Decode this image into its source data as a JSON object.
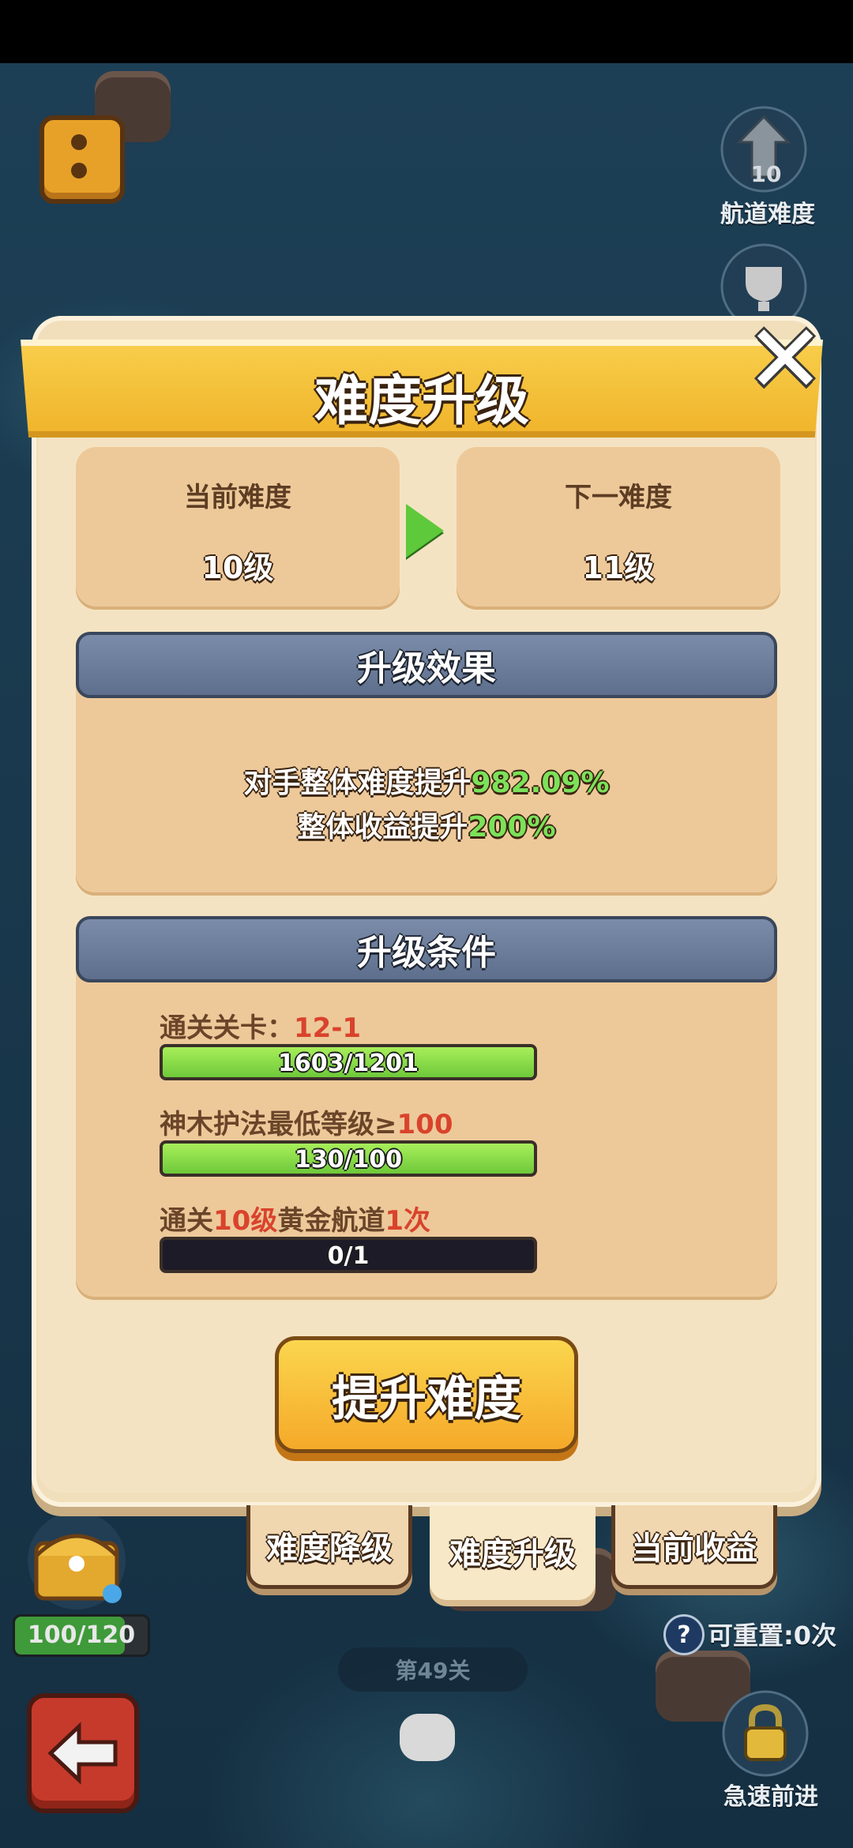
{
  "hud": {
    "route_level": "10",
    "route_difficulty_label": "航道难度",
    "chest_progress": "100/120",
    "chest_fill": 0.83,
    "resettable_label": "可重置:0次",
    "stage_label": "第49关",
    "rush_label": "急速前进"
  },
  "dialog": {
    "title": "难度升级",
    "current": {
      "label": "当前难度",
      "value": "10级"
    },
    "next": {
      "label": "下一难度",
      "value": "11级"
    },
    "effect": {
      "header": "升级效果",
      "line1_prefix": "对手整体难度提升",
      "line1_value": "982.09%",
      "line2_prefix": "整体收益提升",
      "line2_value": "200%"
    },
    "conditions": {
      "header": "升级条件",
      "items": [
        {
          "label": "通关关卡：",
          "highlight": "12-1",
          "progress": "1603/1201",
          "fill": 1.0
        },
        {
          "label": "神木护法最低等级≥",
          "highlight": "100",
          "progress": "130/100",
          "fill": 1.0
        },
        {
          "label_a": "通关",
          "highlight_a": "10级",
          "label_b": "黄金航道",
          "highlight_b": "1次",
          "progress": "0/1",
          "fill": 0.0
        }
      ]
    },
    "button_label": "提升难度"
  },
  "tabs": [
    {
      "label": "难度降级",
      "active": false
    },
    {
      "label": "难度升级",
      "active": true
    },
    {
      "label": "当前收益",
      "active": false
    }
  ]
}
